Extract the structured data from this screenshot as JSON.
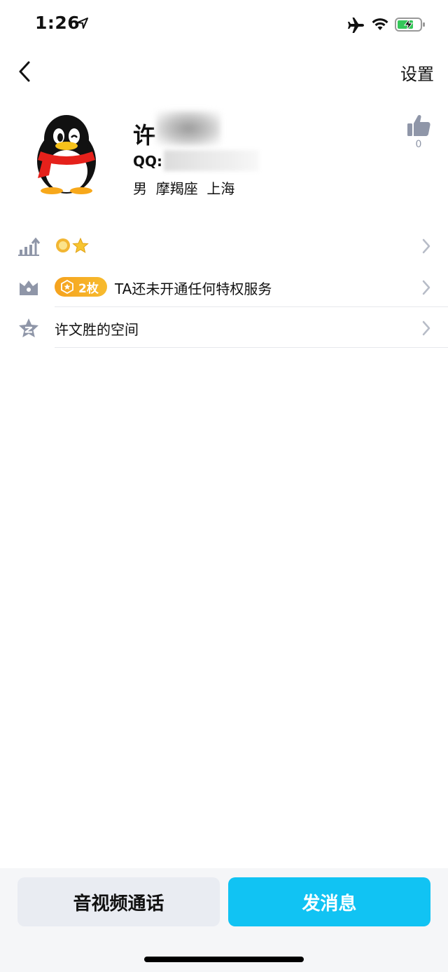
{
  "status_bar": {
    "time": "1:26",
    "icons": [
      "location-arrow-icon",
      "airplane-icon",
      "wifi-icon",
      "battery-charging-icon"
    ]
  },
  "nav": {
    "back_icon": "chevron-left-icon",
    "settings_label": "设置"
  },
  "profile": {
    "avatar": "qq-penguin-avatar",
    "name_visible": "许",
    "qq_label": "QQ:",
    "meta": "男  摩羯座  上海",
    "like_count": "0",
    "like_icon": "thumbs-up-icon"
  },
  "rows": {
    "level": {
      "icon": "level-bars-icon",
      "badges": [
        "sun-icon",
        "star-icon"
      ]
    },
    "vip": {
      "icon": "crown-icon",
      "badge_label": "2枚",
      "badge_icon": "medal-icon",
      "text": "TA还未开通任何特权服务"
    },
    "qzone": {
      "icon": "qzone-star-icon",
      "text": "许文胜的空间"
    }
  },
  "bottom": {
    "call_label": "音视频通话",
    "message_label": "发消息"
  },
  "colors": {
    "accent": "#11c3f3",
    "badge": "#f5a21e",
    "icon_gray": "#8f96a8",
    "secondary_button": "#e9ecf2"
  }
}
